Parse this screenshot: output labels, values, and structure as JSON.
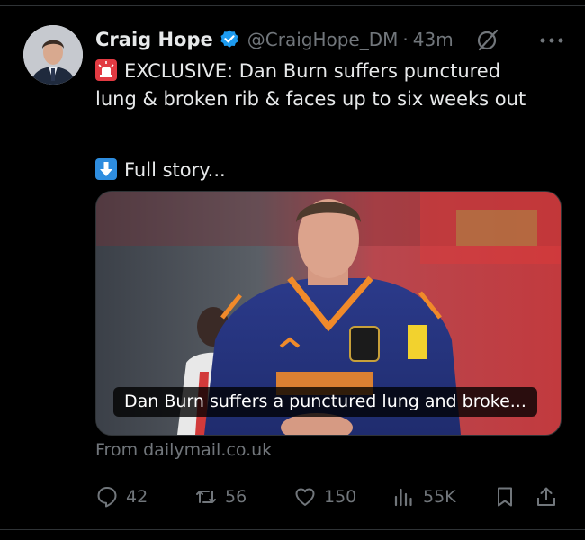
{
  "tweet": {
    "author": {
      "name": "Craig Hope",
      "handle": "@CraigHope_DM",
      "time": "43m",
      "separator": "·"
    },
    "text_line1": "EXCLUSIVE: Dan Burn suffers punctured",
    "text_line2": "lung & broken rib & faces up to six weeks out",
    "text_line3": "Full story...",
    "card": {
      "caption": "Dan Burn suffers a punctured lung and broke...",
      "source": "From dailymail.co.uk"
    },
    "actions": {
      "replies": "42",
      "reposts": "56",
      "likes": "150",
      "views": "55K"
    },
    "icons": {
      "verified": "verified-badge-icon",
      "grok": "grok-icon",
      "more": "more-icon",
      "siren": "police-light-emoji",
      "down_arrow": "down-arrow-emoji"
    },
    "colors": {
      "verified": "#1d9bf0",
      "muted": "#71767b",
      "text": "#e7e9ea",
      "siren": "#e23a42",
      "arrow": "#2e8ddf"
    }
  }
}
